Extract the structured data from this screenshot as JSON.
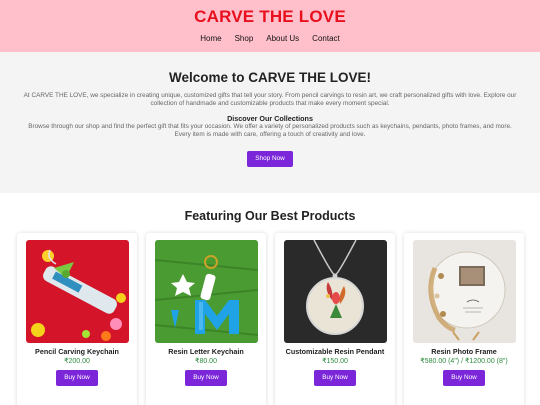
{
  "header": {
    "brand": "CARVE THE LOVE",
    "nav": [
      "Home",
      "Shop",
      "About Us",
      "Contact"
    ]
  },
  "welcome": {
    "title": "Welcome to CARVE THE LOVE!",
    "intro": "At CARVE THE LOVE, we specialize in creating unique, customized gifts that tell your story. From pencil carvings to resin art, we craft personalized gifts with love. Explore our collection of handmade and customizable products that make every moment special.",
    "discover_title": "Discover Our Collections",
    "discover_text": "Browse through our shop and find the perfect gift that fits your occasion. We offer a variety of personalized products such as keychains, pendants, photo frames, and more. Every item is made with care, offering a touch of creativity and love.",
    "shop_button": "Shop Now"
  },
  "featured": {
    "title": "Featuring Our Best Products",
    "products": [
      {
        "name": "Pencil Carving Keychain",
        "price": "₹200.00",
        "button": "Buy Now",
        "image_icon": "pencil-keychain-image"
      },
      {
        "name": "Resin Letter Keychain",
        "price": "₹80.00",
        "button": "Buy Now",
        "image_icon": "resin-letter-keychain-image"
      },
      {
        "name": "Customizable Resin Pendant",
        "price": "₹150.00",
        "button": "Buy Now",
        "image_icon": "resin-pendant-image"
      },
      {
        "name": "Resin Photo Frame",
        "price": "₹580.00 (4\") / ₹1200.00 (8\")",
        "button": "Buy Now",
        "image_icon": "resin-photo-frame-image"
      }
    ]
  },
  "colors": {
    "header_bg": "#ffc0cb",
    "brand": "#e8101e",
    "accent": "#7b27d9",
    "price": "#2e8b3f"
  }
}
